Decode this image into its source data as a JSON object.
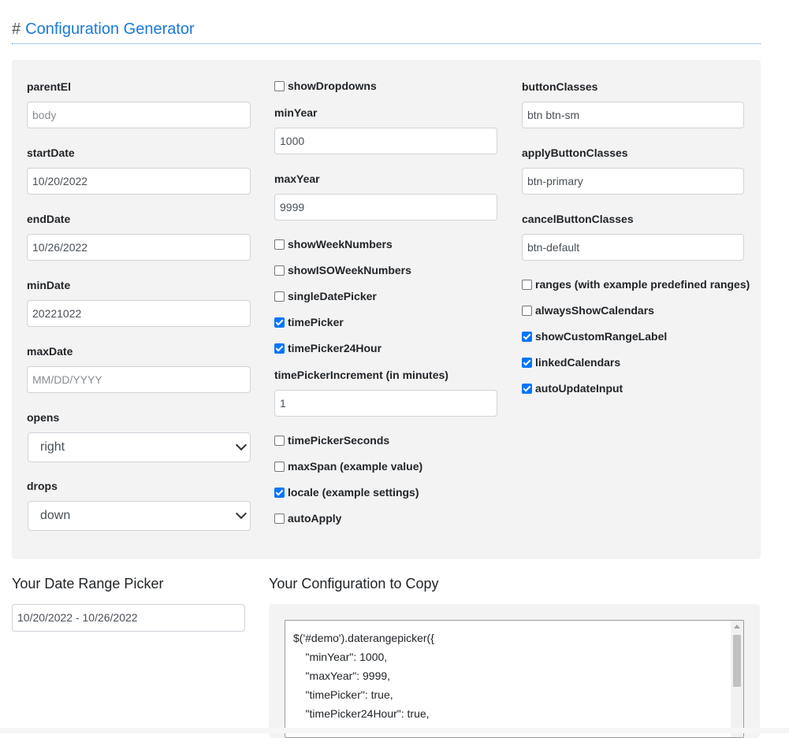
{
  "page": {
    "hash": "#",
    "title": "Configuration Generator"
  },
  "col1": {
    "parentEl": {
      "label": "parentEl",
      "placeholder": "body"
    },
    "startDate": {
      "label": "startDate",
      "value": "10/20/2022"
    },
    "endDate": {
      "label": "endDate",
      "value": "10/26/2022"
    },
    "minDate": {
      "label": "minDate",
      "value": "20221022"
    },
    "maxDate": {
      "label": "maxDate",
      "placeholder": "MM/DD/YYYY"
    },
    "opens": {
      "label": "opens",
      "value": "right"
    },
    "drops": {
      "label": "drops",
      "value": "down"
    }
  },
  "col2": {
    "showDropdowns": {
      "label": "showDropdowns",
      "checked": false
    },
    "minYear": {
      "label": "minYear",
      "value": "1000"
    },
    "maxYear": {
      "label": "maxYear",
      "value": "9999"
    },
    "showWeekNumbers": {
      "label": "showWeekNumbers",
      "checked": false
    },
    "showISOWeekNumbers": {
      "label": "showISOWeekNumbers",
      "checked": false
    },
    "singleDatePicker": {
      "label": "singleDatePicker",
      "checked": false
    },
    "timePicker": {
      "label": "timePicker",
      "checked": true
    },
    "timePicker24Hour": {
      "label": "timePicker24Hour",
      "checked": true
    },
    "timePickerIncrement": {
      "label": "timePickerIncrement (in minutes)",
      "value": "1"
    },
    "timePickerSeconds": {
      "label": "timePickerSeconds",
      "checked": false
    },
    "maxSpan": {
      "label": "maxSpan (example value)",
      "checked": false
    },
    "locale": {
      "label": "locale (example settings)",
      "checked": true
    },
    "autoApply": {
      "label": "autoApply",
      "checked": false
    }
  },
  "col3": {
    "buttonClasses": {
      "label": "buttonClasses",
      "value": "btn btn-sm"
    },
    "applyButtonClasses": {
      "label": "applyButtonClasses",
      "value": "btn-primary"
    },
    "cancelButtonClasses": {
      "label": "cancelButtonClasses",
      "value": "btn-default"
    },
    "ranges": {
      "label": "ranges (with example predefined ranges)",
      "checked": false
    },
    "alwaysShowCalendars": {
      "label": "alwaysShowCalendars",
      "checked": false
    },
    "showCustomRangeLabel": {
      "label": "showCustomRangeLabel",
      "checked": true
    },
    "linkedCalendars": {
      "label": "linkedCalendars",
      "checked": true
    },
    "autoUpdateInput": {
      "label": "autoUpdateInput",
      "checked": true
    }
  },
  "picker": {
    "heading": "Your Date Range Picker",
    "value": "10/20/2022 - 10/26/2022"
  },
  "config": {
    "heading": "Your Configuration to Copy",
    "lines": [
      "$('#demo').daterangepicker({",
      "    \"minYear\": 1000,",
      "    \"maxYear\": 9999,",
      "    \"timePicker\": true,",
      "    \"timePicker24Hour\": true,"
    ]
  },
  "colors": {
    "accent": "#1a7ad8",
    "panel": "#f3f3f3",
    "checkbox": "#0075ff"
  }
}
